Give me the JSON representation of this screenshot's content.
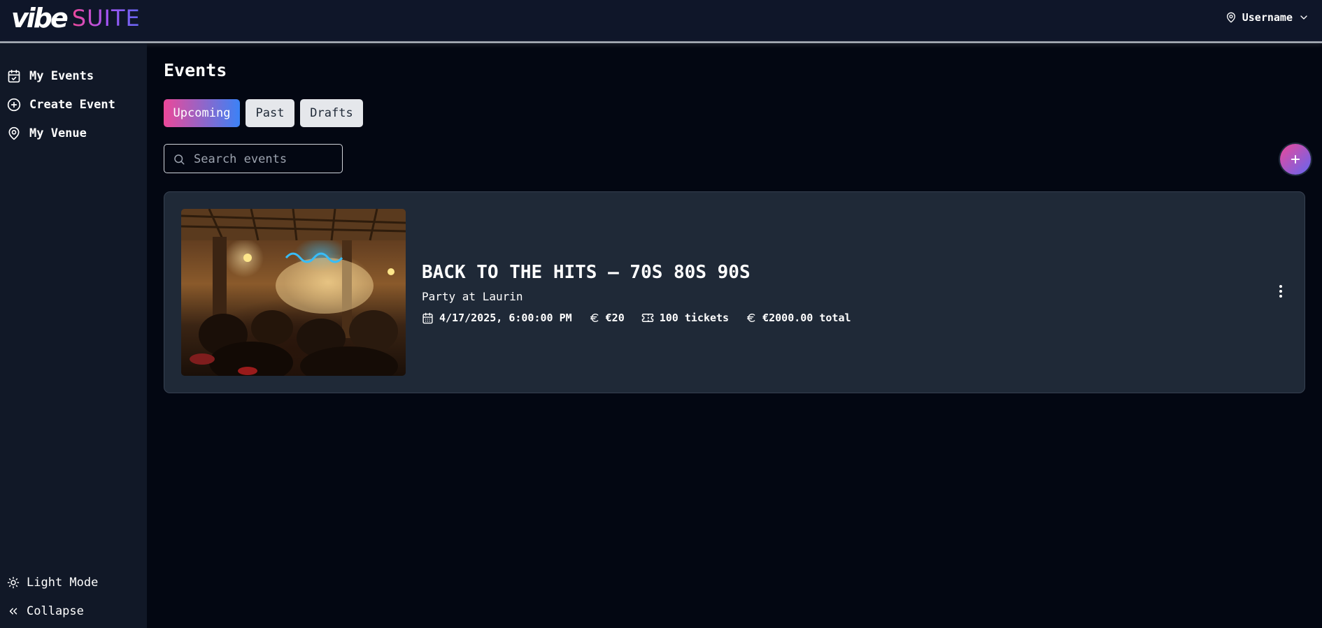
{
  "header": {
    "logo_primary": "vibe",
    "logo_secondary": "SUITE",
    "username": "Username"
  },
  "sidebar": {
    "items": [
      {
        "label": "My Events",
        "icon": "calendar-check-icon"
      },
      {
        "label": "Create Event",
        "icon": "plus-circle-icon"
      },
      {
        "label": "My Venue",
        "icon": "map-pin-icon"
      }
    ],
    "bottom": {
      "light_mode_label": "Light Mode",
      "collapse_label": "Collapse"
    }
  },
  "main": {
    "title": "Events",
    "tabs": [
      {
        "label": "Upcoming",
        "active": true
      },
      {
        "label": "Past",
        "active": false
      },
      {
        "label": "Drafts",
        "active": false
      }
    ],
    "search": {
      "placeholder": "Search events",
      "value": ""
    },
    "add_button_icon": "plus-icon"
  },
  "events": [
    {
      "title": "BACK TO THE HITS – 70S 80S 90S",
      "subtitle": "Party at Laurin",
      "datetime": "4/17/2025, 6:00:00 PM",
      "price": "€20",
      "tickets": "100 tickets",
      "total": "€2000.00 total"
    }
  ],
  "colors": {
    "background": "#030712",
    "header": "#0f1629",
    "sidebar": "#111827",
    "card": "#1f2937",
    "accent_pink": "#ec4899",
    "accent_blue": "#3b82f6"
  }
}
